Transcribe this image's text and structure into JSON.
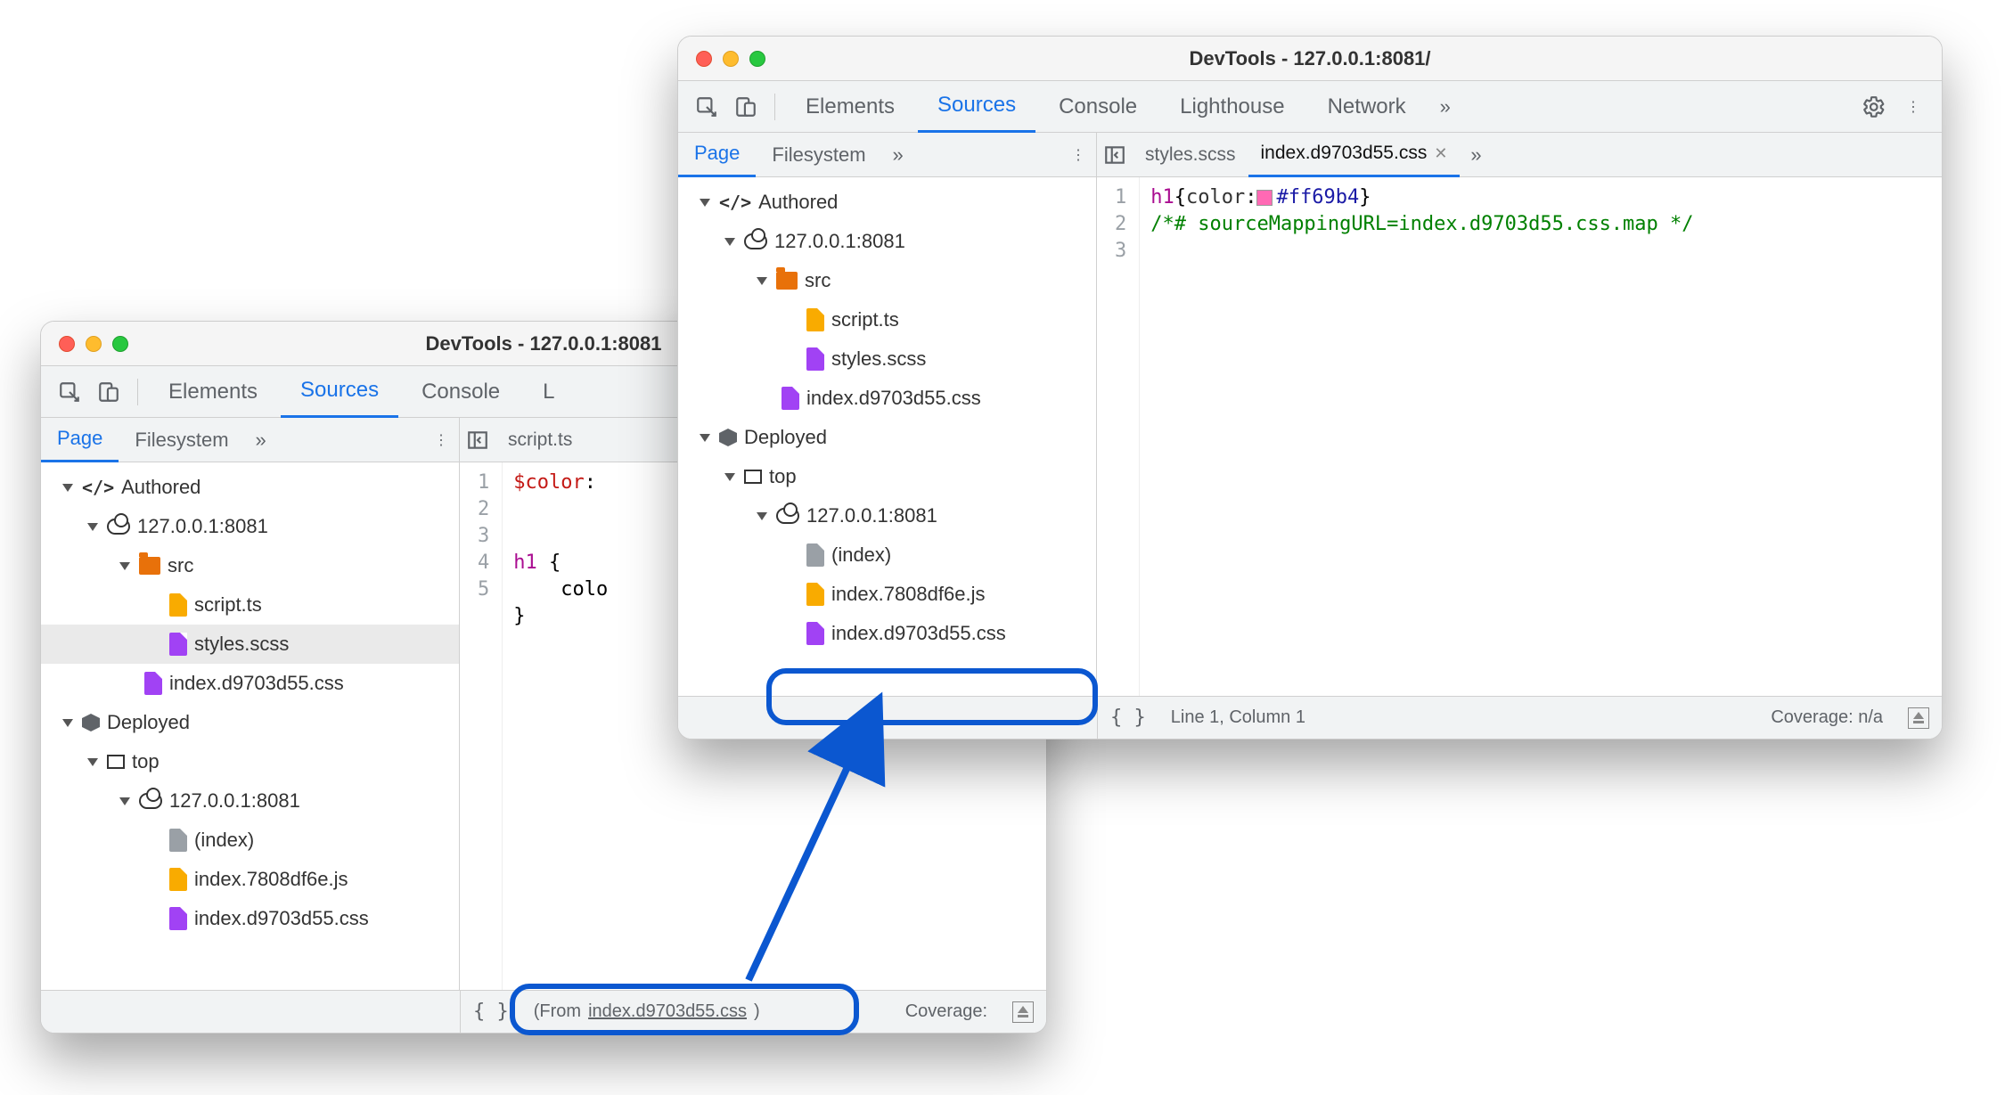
{
  "window_left": {
    "title": "DevTools - 127.0.0.1:8081",
    "main_tabs": [
      "Elements",
      "Sources",
      "Console",
      "L"
    ],
    "main_active": "Sources",
    "sub_tabs": [
      "Page",
      "Filesystem"
    ],
    "sub_active": "Page",
    "editor_tabs": [
      {
        "label": "script.ts",
        "active": false
      }
    ],
    "tree": {
      "authored": "Authored",
      "host": "127.0.0.1:8081",
      "src": "src",
      "files_src": [
        {
          "label": "script.ts",
          "color": "yellow"
        },
        {
          "label": "styles.scss",
          "color": "purple",
          "selected": true
        }
      ],
      "compiled_css": "index.d9703d55.css",
      "deployed": "Deployed",
      "top": "top",
      "host2": "127.0.0.1:8081",
      "deployed_files": [
        {
          "label": "(index)",
          "color": "gray"
        },
        {
          "label": "index.7808df6e.js",
          "color": "yellow"
        },
        {
          "label": "index.d9703d55.css",
          "color": "purple"
        }
      ]
    },
    "code": {
      "lines": [
        "1",
        "2",
        "3",
        "4",
        "5"
      ],
      "l1_a": "$color",
      "l1_b": ":",
      "l3_a": "h1",
      "l3_b": " {",
      "l4": "    colo",
      "l5": "}"
    },
    "status": {
      "from_prefix": "(From ",
      "from_file": "index.d9703d55.css",
      "from_suffix": ")",
      "coverage": "Coverage:"
    }
  },
  "window_right": {
    "title": "DevTools - 127.0.0.1:8081/",
    "main_tabs": [
      "Elements",
      "Sources",
      "Console",
      "Lighthouse",
      "Network"
    ],
    "main_active": "Sources",
    "sub_tabs": [
      "Page",
      "Filesystem"
    ],
    "sub_active": "Page",
    "editor_tabs": [
      {
        "label": "styles.scss",
        "active": false
      },
      {
        "label": "index.d9703d55.css",
        "active": true
      }
    ],
    "tree": {
      "authored": "Authored",
      "host": "127.0.0.1:8081",
      "src": "src",
      "files_src": [
        {
          "label": "script.ts",
          "color": "yellow"
        },
        {
          "label": "styles.scss",
          "color": "purple"
        }
      ],
      "compiled_css": "index.d9703d55.css",
      "deployed": "Deployed",
      "top": "top",
      "host2": "127.0.0.1:8081",
      "deployed_files": [
        {
          "label": "(index)",
          "color": "gray"
        },
        {
          "label": "index.7808df6e.js",
          "color": "yellow"
        },
        {
          "label": "index.d9703d55.css",
          "color": "purple",
          "highlighted": true
        }
      ]
    },
    "code": {
      "lines": [
        "1",
        "2",
        "3"
      ],
      "l1_sel": "h1",
      "l1_brace": "{",
      "l1_prop": "color",
      "l1_colon": ":",
      "l1_hex": "#ff69b4",
      "l1_close": "}",
      "l2": "/*# sourceMappingURL=index.d9703d55.css.map */"
    },
    "status": {
      "pos": "Line 1, Column 1",
      "coverage": "Coverage: n/a"
    }
  }
}
